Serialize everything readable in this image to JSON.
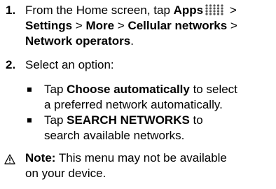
{
  "step1": {
    "number": "1.",
    "line1_prefix": "From the Home screen, tap ",
    "apps_label": "Apps",
    "apps_icon": "apps-grid-icon",
    "line1_suffix": " >",
    "line2_settings": "Settings",
    "line2_sep1": " > ",
    "line2_more": "More",
    "line2_sep2": " > ",
    "line2_cellular": "Cellular networks",
    "line2_sep3": " >",
    "line3_operators": "Network operators",
    "line3_suffix": "."
  },
  "step2": {
    "number": "2.",
    "text": "Select an option:",
    "options": [
      {
        "prefix": "Tap ",
        "bold": "Choose automatically",
        "line1_suffix": " to select",
        "line2": "a preferred network automatically."
      },
      {
        "prefix": "Tap ",
        "bold": "SEARCH NETWORKS",
        "line1_suffix": " to",
        "line2": "search available networks."
      }
    ]
  },
  "note": {
    "icon": "warning-triangle-icon",
    "label": "Note:",
    "line1": " This menu may not be available",
    "line2": "on your device."
  }
}
